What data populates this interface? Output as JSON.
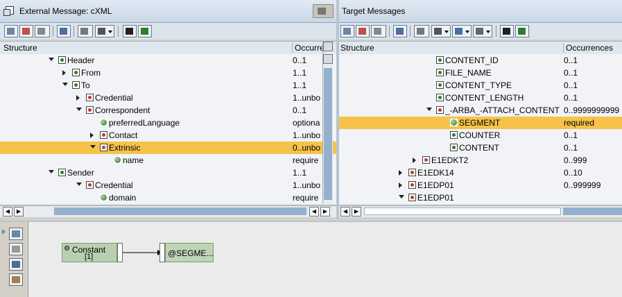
{
  "left_pane": {
    "title": "External Message: cXML",
    "columns": {
      "structure": "Structure",
      "occurrences": "Occurre"
    },
    "rows": [
      {
        "name": "Header",
        "occ": "0..1",
        "toggle": "down",
        "icon": "node",
        "selected": false
      },
      {
        "name": "From",
        "occ": "1..1",
        "toggle": "right",
        "icon": "node",
        "selected": false
      },
      {
        "name": "To",
        "occ": "1..1",
        "toggle": "down",
        "icon": "node",
        "selected": false
      },
      {
        "name": "Credential",
        "occ": "1..unbo",
        "toggle": "right",
        "icon": "node-red",
        "selected": false
      },
      {
        "name": "Correspondent",
        "occ": "0..1",
        "toggle": "down",
        "icon": "node-red",
        "selected": false
      },
      {
        "name": "preferredLanguage",
        "occ": "optiona",
        "toggle": "none",
        "icon": "attr",
        "selected": false
      },
      {
        "name": "Contact",
        "occ": "1..unbo",
        "toggle": "right",
        "icon": "node-red",
        "selected": false
      },
      {
        "name": "Extrinsic",
        "occ": "0..unbo",
        "toggle": "down",
        "icon": "node-red",
        "selected": true
      },
      {
        "name": "name",
        "occ": "require",
        "toggle": "none",
        "icon": "attr",
        "selected": false
      },
      {
        "name": "Sender",
        "occ": "1..1",
        "toggle": "down",
        "icon": "node",
        "selected": false
      },
      {
        "name": "Credential",
        "occ": "1..unbo",
        "toggle": "down",
        "icon": "node-red",
        "selected": false
      },
      {
        "name": "domain",
        "occ": "require",
        "toggle": "none",
        "icon": "attr",
        "selected": false
      }
    ]
  },
  "right_pane": {
    "title": "Target Messages",
    "columns": {
      "structure": "Structure",
      "occurrences": "Occurrences"
    },
    "rows": [
      {
        "name": "CONTENT_ID",
        "occ": "0..1",
        "toggle": "none",
        "icon": "node",
        "selected": false
      },
      {
        "name": "FILE_NAME",
        "occ": "0..1",
        "toggle": "none",
        "icon": "node",
        "selected": false
      },
      {
        "name": "CONTENT_TYPE",
        "occ": "0..1",
        "toggle": "none",
        "icon": "node",
        "selected": false
      },
      {
        "name": "CONTENT_LENGTH",
        "occ": "0..1",
        "toggle": "none",
        "icon": "node",
        "selected": false
      },
      {
        "name": "_-ARBA_-ATTACH_CONTENT",
        "occ": "0..9999999999",
        "toggle": "down",
        "icon": "node-red",
        "selected": false
      },
      {
        "name": "SEGMENT",
        "occ": "required",
        "toggle": "none",
        "icon": "attr",
        "selected": true
      },
      {
        "name": "COUNTER",
        "occ": "0..1",
        "toggle": "none",
        "icon": "node",
        "selected": false
      },
      {
        "name": "CONTENT",
        "occ": "0..1",
        "toggle": "none",
        "icon": "node",
        "selected": false
      },
      {
        "name": "E1EDKT2",
        "occ": "0..999",
        "toggle": "right",
        "icon": "node-red",
        "selected": false
      },
      {
        "name": "E1EDK14",
        "occ": "0..10",
        "toggle": "right",
        "icon": "node-red",
        "selected": false
      },
      {
        "name": "E1EDP01",
        "occ": "0..999999",
        "toggle": "right",
        "icon": "node-red",
        "selected": false
      },
      {
        "name": "E1EDP01",
        "occ": "",
        "toggle": "down",
        "icon": "node-red",
        "selected": false
      }
    ]
  },
  "mapping": {
    "constant_label": "Constant",
    "constant_value": "[1]",
    "target_label": "@SEGME..."
  },
  "colors": {
    "selected_row": "#f6c24a",
    "function_box": "#b8d0b0"
  }
}
